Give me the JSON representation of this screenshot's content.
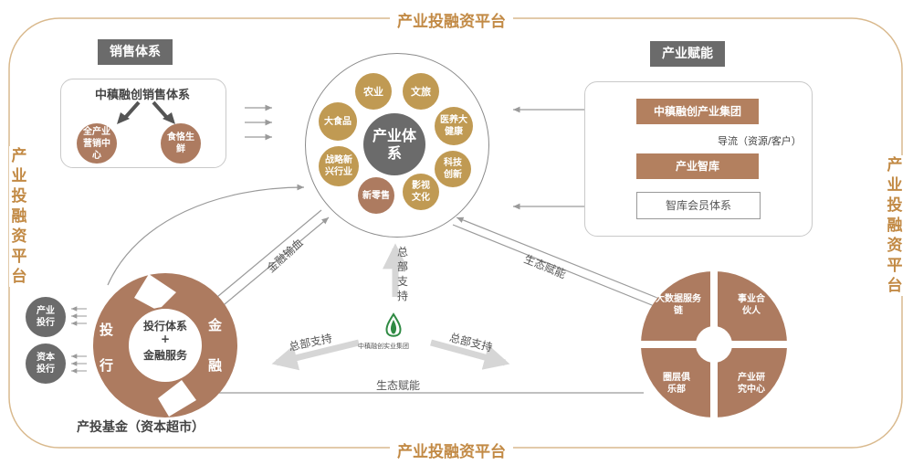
{
  "frame": {
    "top_title": "产业投融资平台",
    "bottom_title": "产业投融资平台",
    "left_title": "产业投融资平台",
    "right_title": "产业投融资平台"
  },
  "sales": {
    "tag": "销售体系",
    "panel_title": "中稹融创销售体系",
    "left_node": "全产业营销中心",
    "right_node": "食恪生鲜"
  },
  "center": {
    "core": "产业体系",
    "nodes": [
      "农业",
      "文旅",
      "医养大健康",
      "科技创新",
      "影视文化",
      "新零售",
      "战略新兴行业",
      "大食品"
    ]
  },
  "empower": {
    "tag": "产业赋能",
    "group": "中稹融创产业集团",
    "flow_label": "导流（资源/客户）",
    "think_tank": "产业智库",
    "members": "智库会员体系"
  },
  "links": {
    "finance_output": "金融输血",
    "hq_support_vertical": "总部支持",
    "eco_empower_upper": "生态赋能",
    "hq_support_left": "总部支持",
    "hq_support_right": "总部支持",
    "eco_empower_bottom": "生态赋能"
  },
  "logo": {
    "caption": "中稹融创实业集团"
  },
  "fund": {
    "center_top": "投行体系",
    "center_plus": "+",
    "center_bottom": "金融服务",
    "left_chars": [
      "投",
      "行"
    ],
    "right_chars": [
      "金",
      "融"
    ],
    "caption": "产投基金（资本超市）",
    "side_nodes": [
      "产业投行",
      "资本投行"
    ]
  },
  "eco": {
    "quadrants": [
      "大数据服务链",
      "事业合伙人",
      "圈层俱乐部",
      "产业研究中心"
    ]
  },
  "colors": {
    "gold": "#c09a53",
    "brown": "#ad7b60",
    "dark_gray": "#6b6b6b",
    "frame": "#c28a45"
  }
}
